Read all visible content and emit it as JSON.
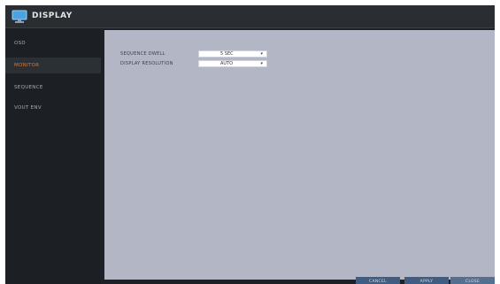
{
  "window": {
    "title": "DISPLAY"
  },
  "sidebar": {
    "items": [
      {
        "label": "OSD",
        "active": false
      },
      {
        "label": "MONITOR",
        "active": true
      },
      {
        "label": "SEQUENCE",
        "active": false
      },
      {
        "label": "VOUT ENV",
        "active": false
      }
    ]
  },
  "monitor": {
    "rows": [
      {
        "label": "SEQUENCE DWELL",
        "value": "5 SEC"
      },
      {
        "label": "DISPLAY RESOLUTION",
        "value": "AUTO"
      }
    ]
  },
  "buttons": {
    "cancel": "CANCEL",
    "apply": "APPLY",
    "close": "CLOSE"
  },
  "colors": {
    "accent": "#e0762c",
    "content_bg": "#b3b6c5",
    "button": "#3f5d82"
  }
}
